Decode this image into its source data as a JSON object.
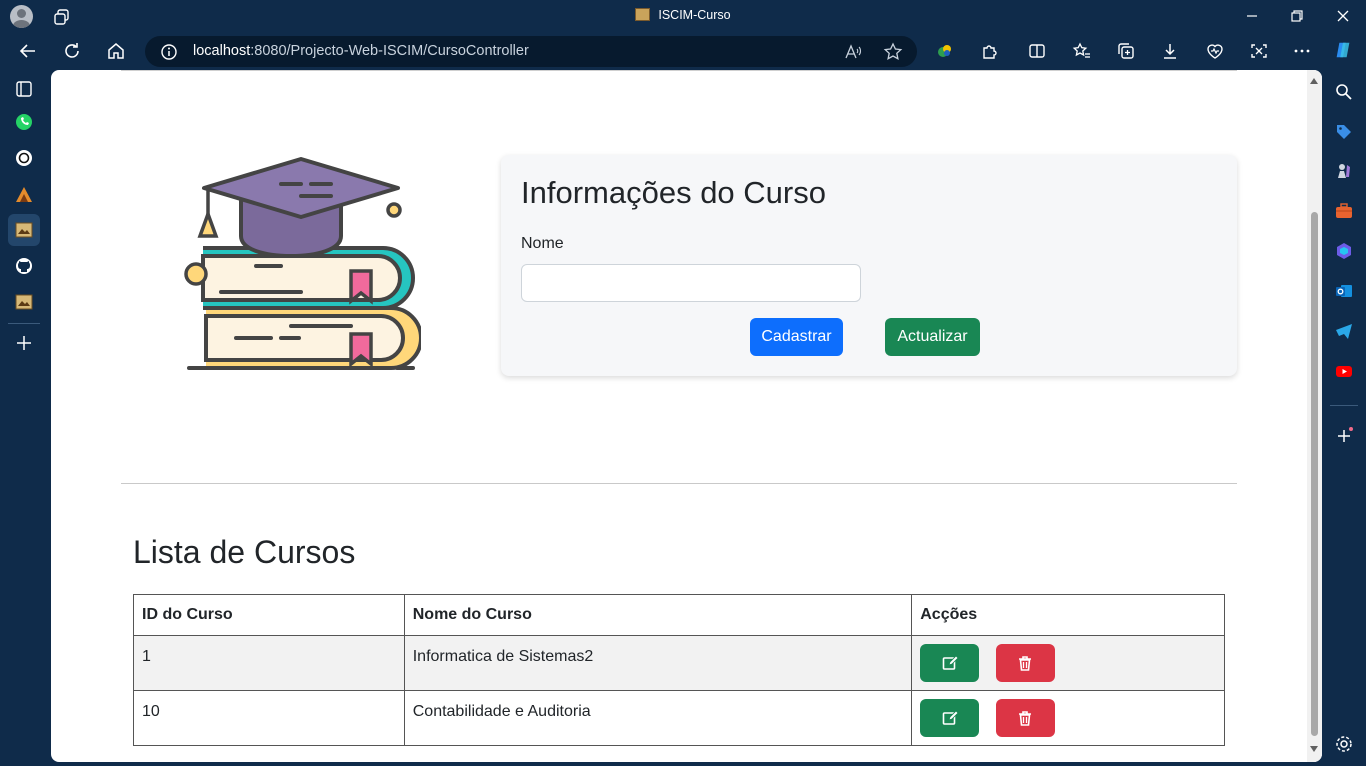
{
  "browser": {
    "window_title": "ISCIM-Curso",
    "url_host": "localhost",
    "url_path": ":8080/Projecto-Web-ISCIM/CursoController"
  },
  "form": {
    "title": "Informações do Curso",
    "name_label": "Nome",
    "name_value": "",
    "register_button": "Cadastrar",
    "update_button": "Actualizar"
  },
  "list": {
    "title": "Lista de Cursos",
    "columns": [
      "ID do Curso",
      "Nome do Curso",
      "Acções"
    ],
    "rows": [
      {
        "id": "1",
        "name": "Informatica de Sistemas2"
      },
      {
        "id": "10",
        "name": "Contabilidade e Auditoria"
      }
    ]
  },
  "colors": {
    "primary": "#0d6efd",
    "success": "#198754",
    "danger": "#dc3545",
    "browser_chrome": "#0f2b4a"
  },
  "icons": {
    "edit": "pencil-square-icon",
    "delete": "trash-icon"
  }
}
